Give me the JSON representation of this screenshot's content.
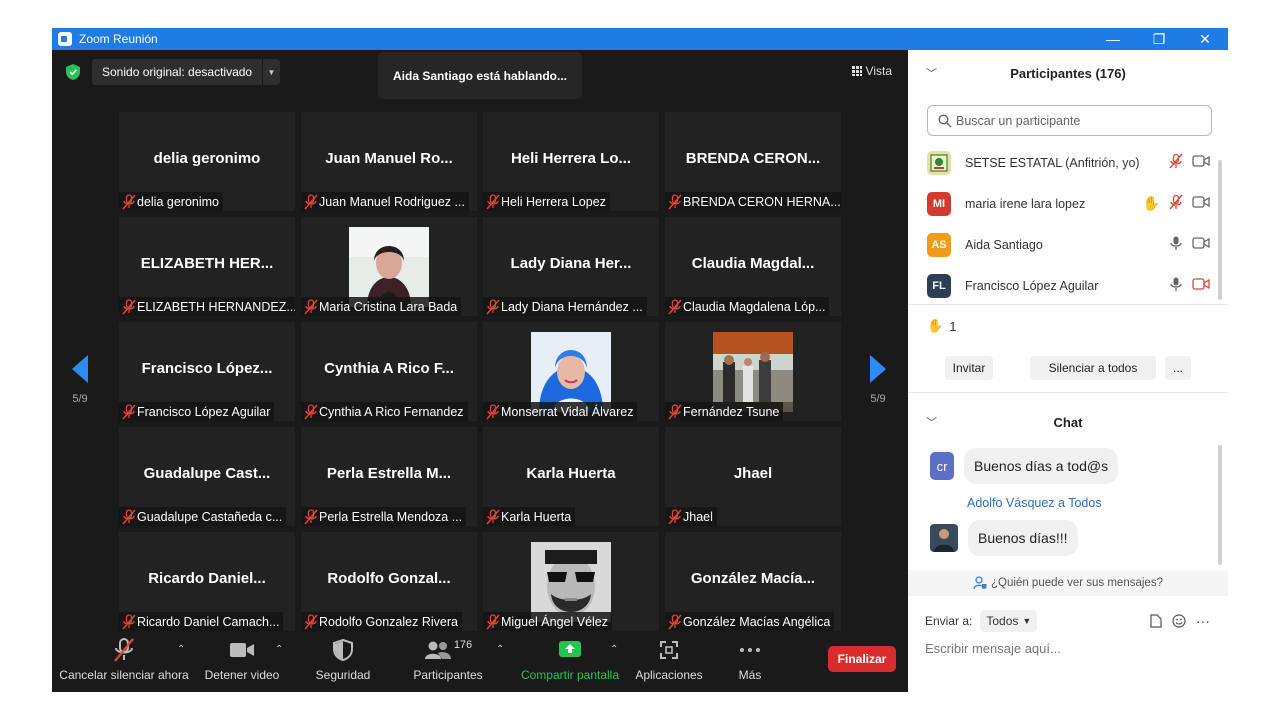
{
  "window": {
    "title": "Zoom Reunión",
    "minimize": "—",
    "restore": "❐",
    "close": "✕"
  },
  "meeting": {
    "audio_dropdown": "Sonido original: desactivado",
    "speaking_banner": "Aida Santiago está hablando...",
    "view_label": "Vista",
    "page_left": "5/9",
    "page_right": "5/9",
    "tiles": [
      {
        "big": "delia geronimo",
        "name": "delia geronimo"
      },
      {
        "big": "Juan Manuel Ro...",
        "name": "Juan Manuel Rodriguez ..."
      },
      {
        "big": "Heli Herrera Lo...",
        "name": "Heli Herrera Lopez"
      },
      {
        "big": "BRENDA CERON...",
        "name": "BRENDA CERON HERNA..."
      },
      {
        "big": "ELIZABETH HER...",
        "name": "ELIZABETH HERNANDEZ..."
      },
      {
        "big": "",
        "name": "Maria Cristina Lara Bada",
        "photo": "woman"
      },
      {
        "big": "Lady Diana Her...",
        "name": "Lady Diana Hernández ..."
      },
      {
        "big": "Claudia Magdal...",
        "name": "Claudia Magdalena Lóp..."
      },
      {
        "big": "Francisco López...",
        "name": "Francisco López Aguilar"
      },
      {
        "big": "Cynthia A Rico F...",
        "name": "Cynthia A Rico Fernandez"
      },
      {
        "big": "",
        "name": "Monserrat Vidal Álvarez",
        "photo": "blue"
      },
      {
        "big": "",
        "name": "Fernández Tsune",
        "photo": "group"
      },
      {
        "big": "Guadalupe Cast...",
        "name": "Guadalupe Castañeda c..."
      },
      {
        "big": "Perla Estrella M...",
        "name": "Perla Estrella Mendoza ..."
      },
      {
        "big": "Karla Huerta",
        "name": "Karla Huerta"
      },
      {
        "big": "Jhael",
        "name": "Jhael"
      },
      {
        "big": "Ricardo Daniel...",
        "name": "Ricardo Daniel Camach..."
      },
      {
        "big": "Rodolfo Gonzal...",
        "name": "Rodolfo Gonzalez Rivera"
      },
      {
        "big": "",
        "name": "Miguel Ángel Vélez",
        "photo": "bw"
      },
      {
        "big": "González Macía...",
        "name": "González Macías Angélica"
      }
    ]
  },
  "toolbar": {
    "unmute": "Cancelar silenciar ahora",
    "stop_video": "Detener video",
    "security": "Seguridad",
    "participants": "Participantes",
    "participants_count": "176",
    "share": "Compartir pantalla",
    "apps": "Aplicaciones",
    "more": "Más",
    "end": "Finalizar"
  },
  "participants_panel": {
    "title": "Participantes (176)",
    "search_placeholder": "Buscar un participante",
    "list": [
      {
        "initials": "",
        "name": "SETSE ESTATAL (Anfitrión, yo)",
        "color": "#e8e0a0"
      },
      {
        "initials": "MI",
        "name": "maria irene lara lopez",
        "color": "#d33a2e"
      },
      {
        "initials": "AS",
        "name": "Aida Santiago",
        "color": "#f29a1a"
      },
      {
        "initials": "FL",
        "name": "Francisco López Aguilar",
        "color": "#2d3f55"
      }
    ],
    "hands_count": "1",
    "invite": "Invitar",
    "mute_all": "Silenciar a todos",
    "more": "..."
  },
  "chat": {
    "title": "Chat",
    "messages": [
      {
        "avatar": "cr",
        "text": "Buenos días a tod@s"
      },
      {
        "sender": "Adolfo Vásquez a Todos",
        "text": "Buenos días!!!"
      }
    ],
    "who_can_see": "¿Quién puede ver sus mensajes?",
    "send_to_label": "Enviar a:",
    "send_to_value": "Todos",
    "placeholder": "Escribir mensaje aquí..."
  },
  "colors": {
    "accent": "#1f7be6",
    "end_button": "#d92d2d",
    "share_green": "#23c552",
    "muted_red": "#e0453a"
  }
}
